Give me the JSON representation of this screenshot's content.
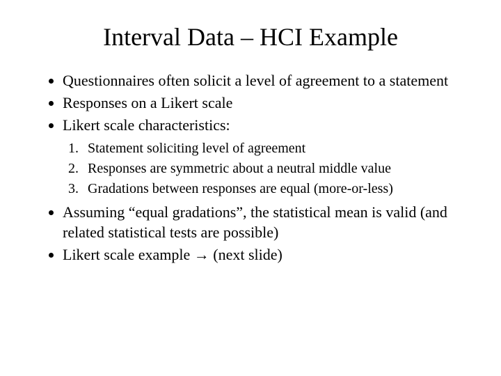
{
  "title": "Interval Data – HCI Example",
  "bullets": {
    "b1": "Questionnaires often solicit a level of agreement to a statement",
    "b2": "Responses on a Likert scale",
    "b3": "Likert scale characteristics:",
    "b4": "Assuming “equal gradations”, the statistical mean is valid (and related statistical tests are possible)",
    "b5_pre": "Likert scale example ",
    "b5_arrow": "→",
    "b5_post": " (next slide)"
  },
  "nested": {
    "n1": "Statement soliciting level of agreement",
    "n2": "Responses are symmetric about a neutral middle value",
    "n3": "Gradations between responses are equal (more-or-less)"
  }
}
